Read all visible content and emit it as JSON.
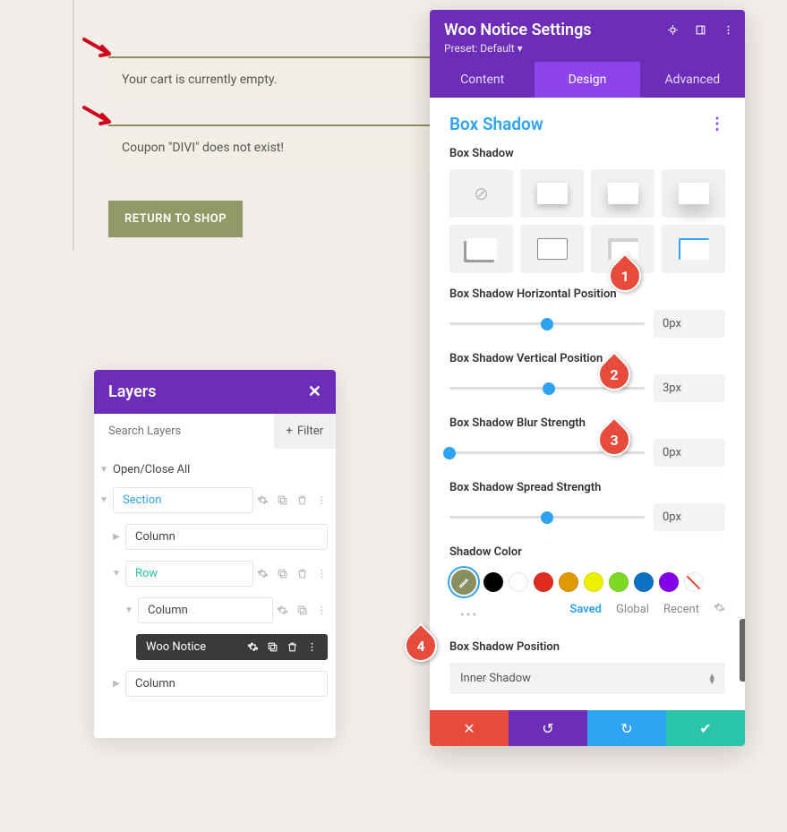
{
  "notices": {
    "empty_cart": "Your cart is currently empty.",
    "coupon_error": "Coupon \"DIVI\" does not exist!",
    "return_button": "RETURN TO SHOP"
  },
  "layers": {
    "title": "Layers",
    "search_placeholder": "Search Layers",
    "filter_label": "Filter",
    "open_close": "Open/Close All",
    "items": {
      "section": "Section",
      "column1": "Column",
      "row": "Row",
      "column2": "Column",
      "woo_notice": "Woo Notice",
      "column3": "Column"
    }
  },
  "settings": {
    "title": "Woo Notice Settings",
    "preset_label": "Preset: Default",
    "tabs": {
      "content": "Content",
      "design": "Design",
      "advanced": "Advanced"
    },
    "section_title": "Box Shadow",
    "box_shadow_label": "Box Shadow",
    "horiz_label": "Box Shadow Horizontal Position",
    "horiz_val": "0px",
    "vert_label": "Box Shadow Vertical Position",
    "vert_val": "3px",
    "blur_label": "Box Shadow Blur Strength",
    "blur_val": "0px",
    "spread_label": "Box Shadow Spread Strength",
    "spread_val": "0px",
    "shadow_color_label": "Shadow Color",
    "color_tabs": {
      "saved": "Saved",
      "global": "Global",
      "recent": "Recent"
    },
    "position_label": "Box Shadow Position",
    "position_val": "Inner Shadow",
    "colors": {
      "active": "#8a8f5f",
      "black": "#000000",
      "white": "#ffffff",
      "red": "#e02b20",
      "orange": "#e09900",
      "yellow": "#edf000",
      "green": "#7cda24",
      "blue": "#0c71c3",
      "purple": "#8300e9"
    }
  },
  "callouts": {
    "c1": "1",
    "c2": "2",
    "c3": "3",
    "c4": "4"
  }
}
